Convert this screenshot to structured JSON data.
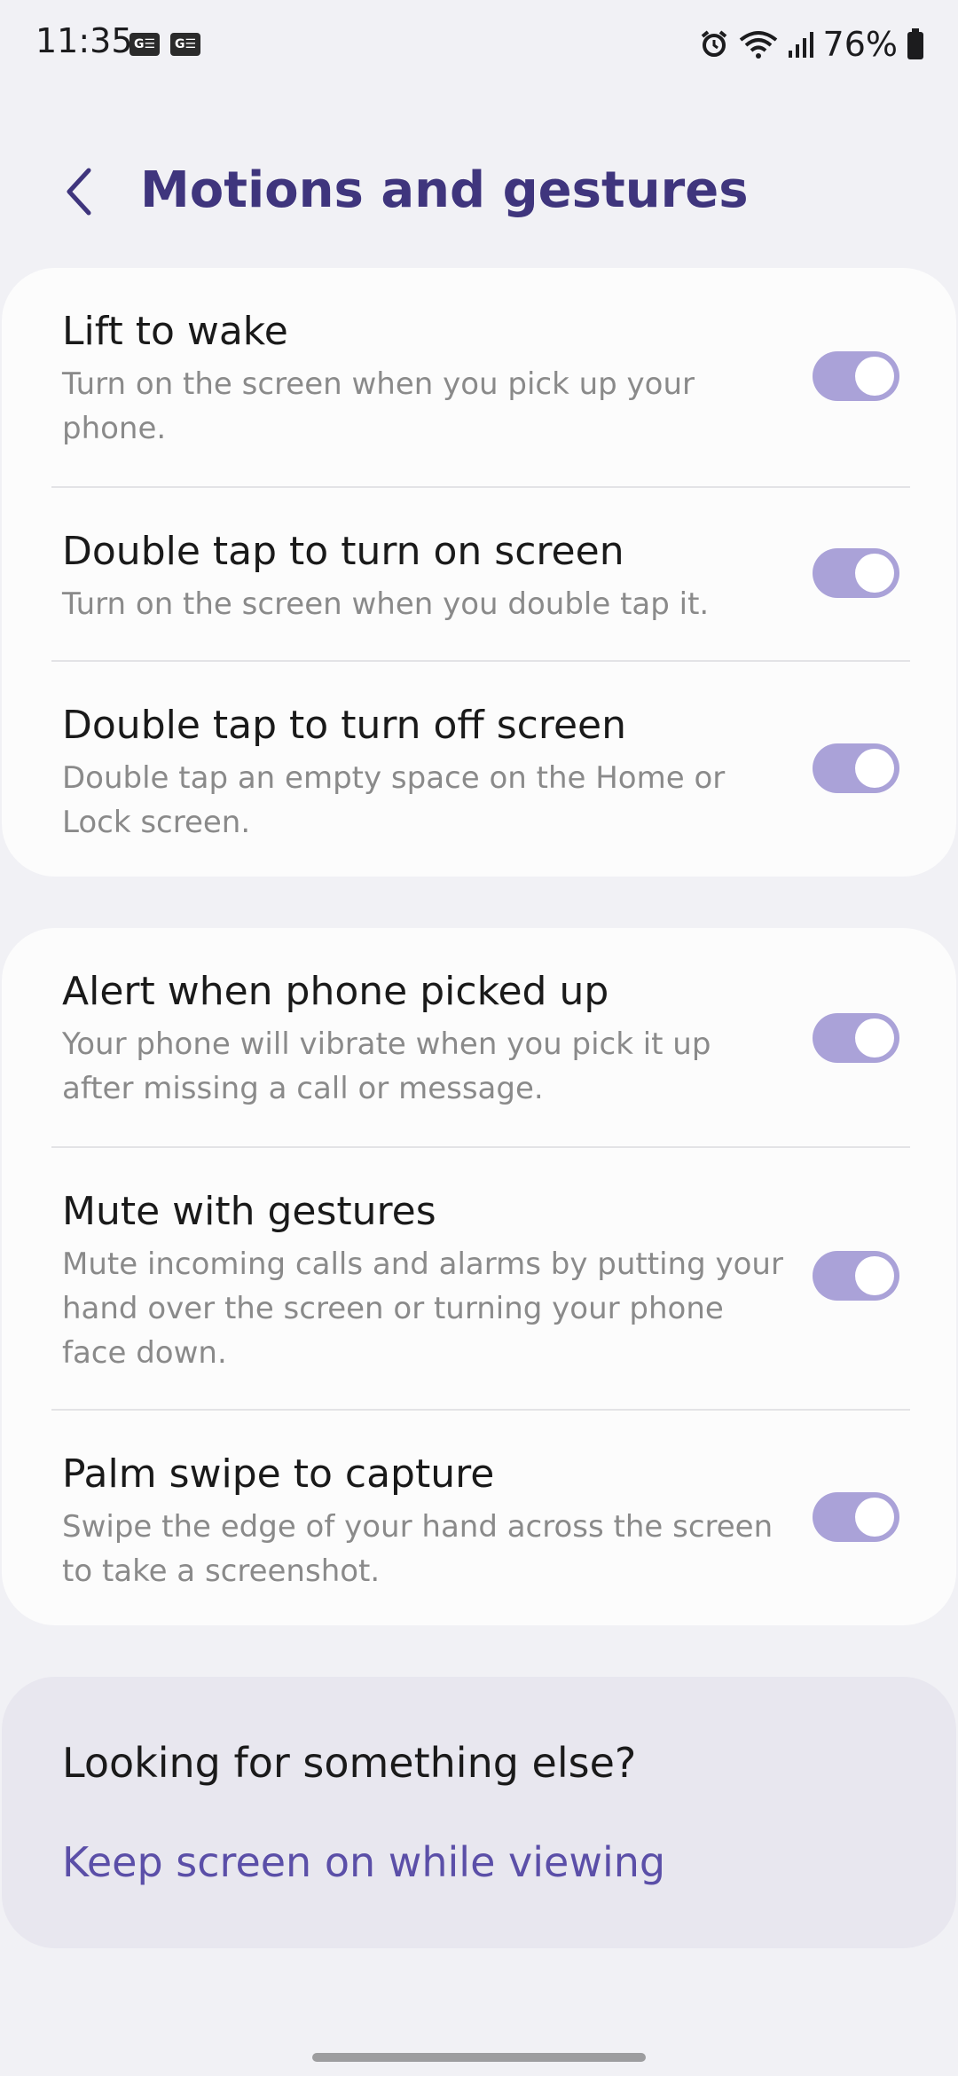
{
  "status_bar": {
    "time": "11:35",
    "notif_icons": [
      "G☰",
      "G☰"
    ],
    "battery": "76%"
  },
  "header": {
    "title": "Motions and gestures"
  },
  "section1": [
    {
      "title": "Lift to wake",
      "desc": "Turn on the screen when you pick up your phone.",
      "enabled": true
    },
    {
      "title": "Double tap to turn on screen",
      "desc": "Turn on the screen when you double tap it.",
      "enabled": true
    },
    {
      "title": "Double tap to turn off screen",
      "desc": "Double tap an empty space on the Home or Lock screen.",
      "enabled": true
    }
  ],
  "section2": [
    {
      "title": "Alert when phone picked up",
      "desc": "Your phone will vibrate when you pick it up after missing a call or message.",
      "enabled": true
    },
    {
      "title": "Mute with gestures",
      "desc": "Mute incoming calls and alarms by putting your hand over the screen or turning your phone face down.",
      "enabled": true
    },
    {
      "title": "Palm swipe to capture",
      "desc": "Swipe the edge of your hand across the screen to take a screenshot.",
      "enabled": true
    }
  ],
  "suggestions": {
    "heading": "Looking for something else?",
    "link": "Keep screen on while viewing"
  },
  "colors": {
    "accent": "#3f357d",
    "toggle_on": "#aaa2d8",
    "link": "#5b4fa8",
    "background": "#f1f1f5"
  }
}
